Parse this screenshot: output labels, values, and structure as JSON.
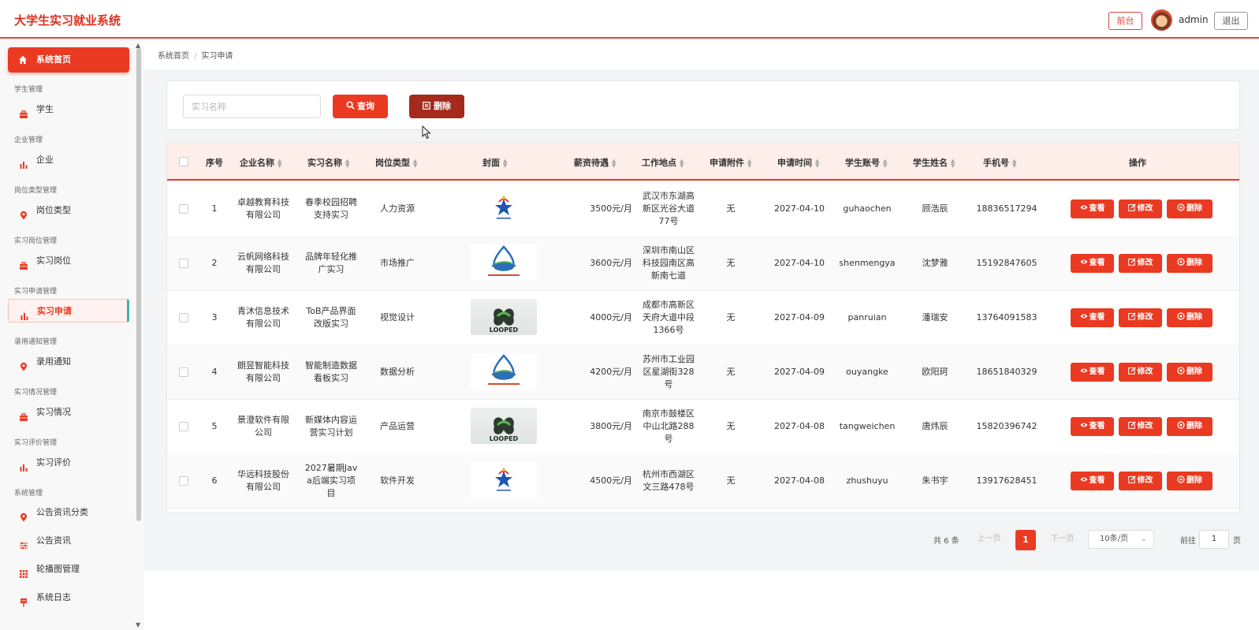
{
  "header": {
    "title": "大学生实习就业系统",
    "front_label": "前台",
    "username": "admin",
    "logout_label": "退出"
  },
  "sidebar": {
    "home": "系统首页",
    "groups": [
      {
        "label": "学生管理",
        "item": "学生",
        "icon": "briefcase-icon"
      },
      {
        "label": "企业管理",
        "item": "企业",
        "icon": "bar-chart-icon"
      },
      {
        "label": "岗位类型管理",
        "item": "岗位类型",
        "icon": "map-pin-icon"
      },
      {
        "label": "实习岗位管理",
        "item": "实习岗位",
        "icon": "briefcase-icon"
      },
      {
        "label": "实习申请管理",
        "item": "实习申请",
        "icon": "bar-chart-icon"
      },
      {
        "label": "录用通知管理",
        "item": "录用通知",
        "icon": "map-pin-icon"
      },
      {
        "label": "实习情况管理",
        "item": "实习情况",
        "icon": "briefcase-icon"
      },
      {
        "label": "实习评价管理",
        "item": "实习评价",
        "icon": "bar-chart-icon"
      }
    ],
    "system_label": "系统管理",
    "system_items": [
      "公告资讯分类",
      "公告资讯",
      "轮播图管理",
      "系统日志"
    ]
  },
  "breadcrumb": {
    "home": "系统首页",
    "current": "实习申请"
  },
  "search": {
    "placeholder": "实习名称",
    "query_label": "查询",
    "delete_label": "删除"
  },
  "table": {
    "headers": [
      "序号",
      "企业名称",
      "实习名称",
      "岗位类型",
      "封面",
      "薪资待遇",
      "工作地点",
      "申请附件",
      "申请时间",
      "学生账号",
      "学生姓名",
      "手机号",
      "操作"
    ],
    "actions": {
      "view": "查看",
      "edit": "修改",
      "delete": "删除"
    },
    "rows": [
      {
        "no": "1",
        "company": [
          "卓越教育科技",
          "有限公司"
        ],
        "name": [
          "春季校园招聘",
          "支持实习"
        ],
        "type": "人力资源",
        "cover": "star-logo",
        "salary": "3500元/月",
        "location": [
          "武汉市东湖高",
          "新区光谷大道",
          "77号"
        ],
        "attachment": "无",
        "date": "2027-04-10",
        "account": "guhaochen",
        "student": "顾浩辰",
        "phone": "18836517294"
      },
      {
        "no": "2",
        "company": [
          "云帆网络科技",
          "有限公司"
        ],
        "name": [
          "品牌年轻化推",
          "广实习"
        ],
        "type": "市场推广",
        "cover": "wave-logo",
        "salary": "3600元/月",
        "location": [
          "深圳市南山区",
          "科技园南区高",
          "新南七道"
        ],
        "attachment": "无",
        "date": "2027-04-10",
        "account": "shenmengya",
        "student": "沈梦雅",
        "phone": "15192847605"
      },
      {
        "no": "3",
        "company": [
          "青沐信息技术",
          "有限公司"
        ],
        "name": [
          "ToB产品界面",
          "改版实习"
        ],
        "type": "视觉设计",
        "cover": "looped-logo",
        "salary": "4000元/月",
        "location": [
          "成都市高新区",
          "天府大道中段",
          "1366号"
        ],
        "attachment": "无",
        "date": "2027-04-09",
        "account": "panruian",
        "student": "潘瑞安",
        "phone": "13764091583"
      },
      {
        "no": "4",
        "company": [
          "朗昱智能科技",
          "有限公司"
        ],
        "name": [
          "智能制造数据",
          "看板实习"
        ],
        "type": "数据分析",
        "cover": "wave-logo",
        "salary": "4200元/月",
        "location": [
          "苏州市工业园",
          "区星湖街328",
          "号"
        ],
        "attachment": "无",
        "date": "2027-04-09",
        "account": "ouyangke",
        "student": "欧阳珂",
        "phone": "18651840329"
      },
      {
        "no": "5",
        "company": [
          "景澄软件有限",
          "公司"
        ],
        "name": [
          "新媒体内容运",
          "营实习计划"
        ],
        "type": "产品运营",
        "cover": "looped-logo",
        "salary": "3800元/月",
        "location": [
          "南京市鼓楼区",
          "中山北路288",
          "号"
        ],
        "attachment": "无",
        "date": "2027-04-08",
        "account": "tangweichen",
        "student": "唐炜辰",
        "phone": "15820396742"
      },
      {
        "no": "6",
        "company": [
          "华远科技股份",
          "有限公司"
        ],
        "name": [
          "2027暑期Jav",
          "a后端实习项",
          "目"
        ],
        "type": "软件开发",
        "cover": "star-logo",
        "salary": "4500元/月",
        "location": [
          "杭州市西湖区",
          "文三路478号"
        ],
        "attachment": "无",
        "date": "2027-04-08",
        "account": "zhushuyu",
        "student": "朱书宇",
        "phone": "13917628451"
      }
    ]
  },
  "pagination": {
    "total": "共 6 条",
    "prev": "上一页",
    "page": "1",
    "next": "下一页",
    "size": "10条/页",
    "goto": "前往",
    "goto_value": "1",
    "page_suffix": "页"
  },
  "colors": {
    "primary": "#ea3a22",
    "dark_delete": "#a52a1c",
    "header_bg": "#fdeeea"
  }
}
